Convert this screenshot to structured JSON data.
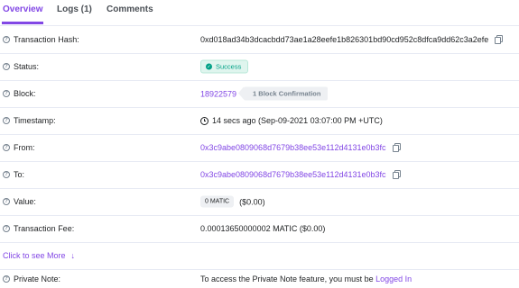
{
  "tabs": [
    {
      "label": "Overview",
      "active": true
    },
    {
      "label": "Logs (1)",
      "active": false
    },
    {
      "label": "Comments",
      "active": false
    }
  ],
  "rows": {
    "tx_hash": {
      "label": "Transaction Hash:",
      "value": "0xd018ad34b3dcacbdd73ae1a28eefe1b826301bd90cd952c8dfca9dd62c3a2efe"
    },
    "status": {
      "label": "Status:",
      "value": "Success"
    },
    "block": {
      "label": "Block:",
      "number": "18922579",
      "confirmations": "1 Block Confirmation"
    },
    "timestamp": {
      "label": "Timestamp:",
      "value": "14 secs ago (Sep-09-2021 03:07:00 PM +UTC)"
    },
    "from": {
      "label": "From:",
      "value": "0x3c9abe0809068d7679b38ee53e112d4131e0b3fc"
    },
    "to": {
      "label": "To:",
      "value": "0x3c9abe0809068d7679b38ee53e112d4131e0b3fc"
    },
    "value": {
      "label": "Value:",
      "badge": "0 MATIC",
      "usd": "($0.00)"
    },
    "fee": {
      "label": "Transaction Fee:",
      "value": "0.00013650000002 MATIC ($0.00)"
    },
    "see_more": {
      "label": "Click to see More"
    },
    "private_note": {
      "label": "Private Note:",
      "text": "To access the Private Note feature, you must be",
      "link": "Logged In"
    }
  },
  "icons": {
    "help": "question-circle-icon",
    "copy": "copy-icon",
    "check": "check-circle-icon",
    "clock": "clock-icon",
    "arrow": "arrow-down-icon"
  },
  "colors": {
    "accent": "#8247e5",
    "success": "#00a186",
    "success_bg": "#dff5ee",
    "border": "#e7eaf3"
  }
}
